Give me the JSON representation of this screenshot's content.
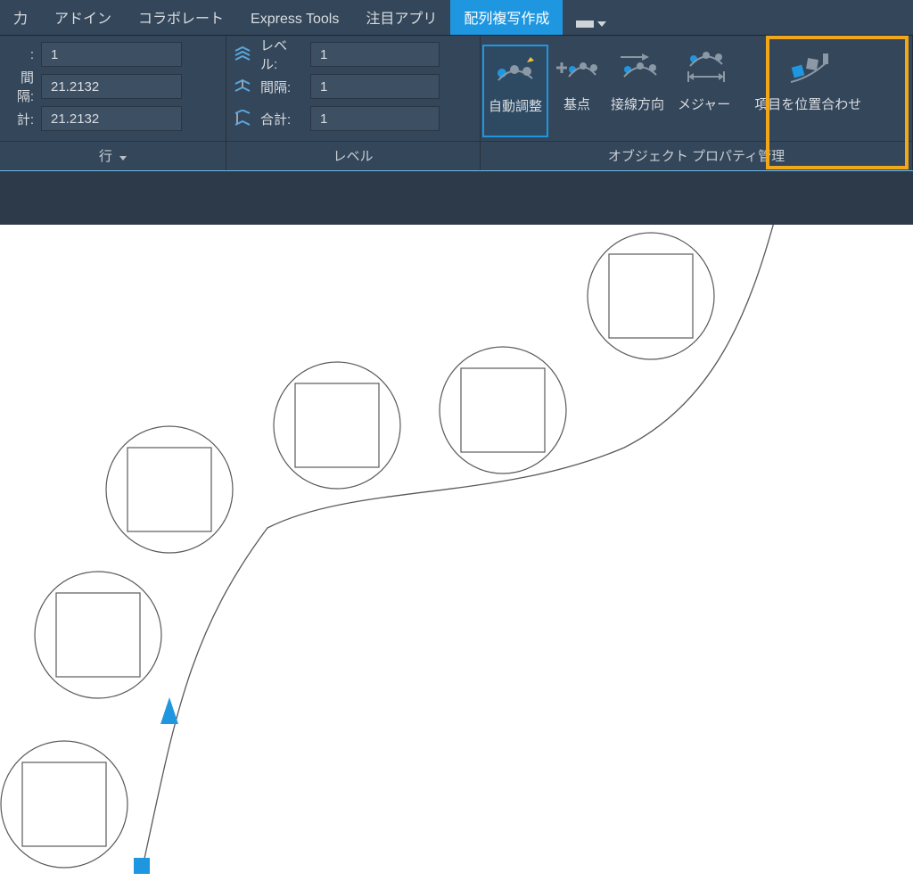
{
  "tabs": {
    "t0": "力",
    "t1": "アドイン",
    "t2": "コラボレート",
    "t3": "Express Tools",
    "t4": "注目アプリ",
    "t5": "配列複写作成"
  },
  "row_panel": {
    "r0_label": ":",
    "r0_value": "1",
    "r1_label": "間隔:",
    "r1_value": "21.2132",
    "r2_label": "計:",
    "r2_value": "21.2132",
    "title": "行"
  },
  "level_panel": {
    "r0_label": "レベル:",
    "r0_value": "1",
    "r1_label": "間隔:",
    "r1_value": "1",
    "r2_label": "合計:",
    "r2_value": "1",
    "title": "レベル"
  },
  "buttons": {
    "auto_fit": "自動調整",
    "base_point": "基点",
    "tangent_dir": "接線方向",
    "measure": "メジャー",
    "align_items": "項目を位置合わせ"
  },
  "props_panel_title": "オブジェクト プロパティ管理",
  "colors": {
    "accent": "#1f97e0",
    "highlight": "#f2a71b",
    "grip": "#1f97e0"
  }
}
